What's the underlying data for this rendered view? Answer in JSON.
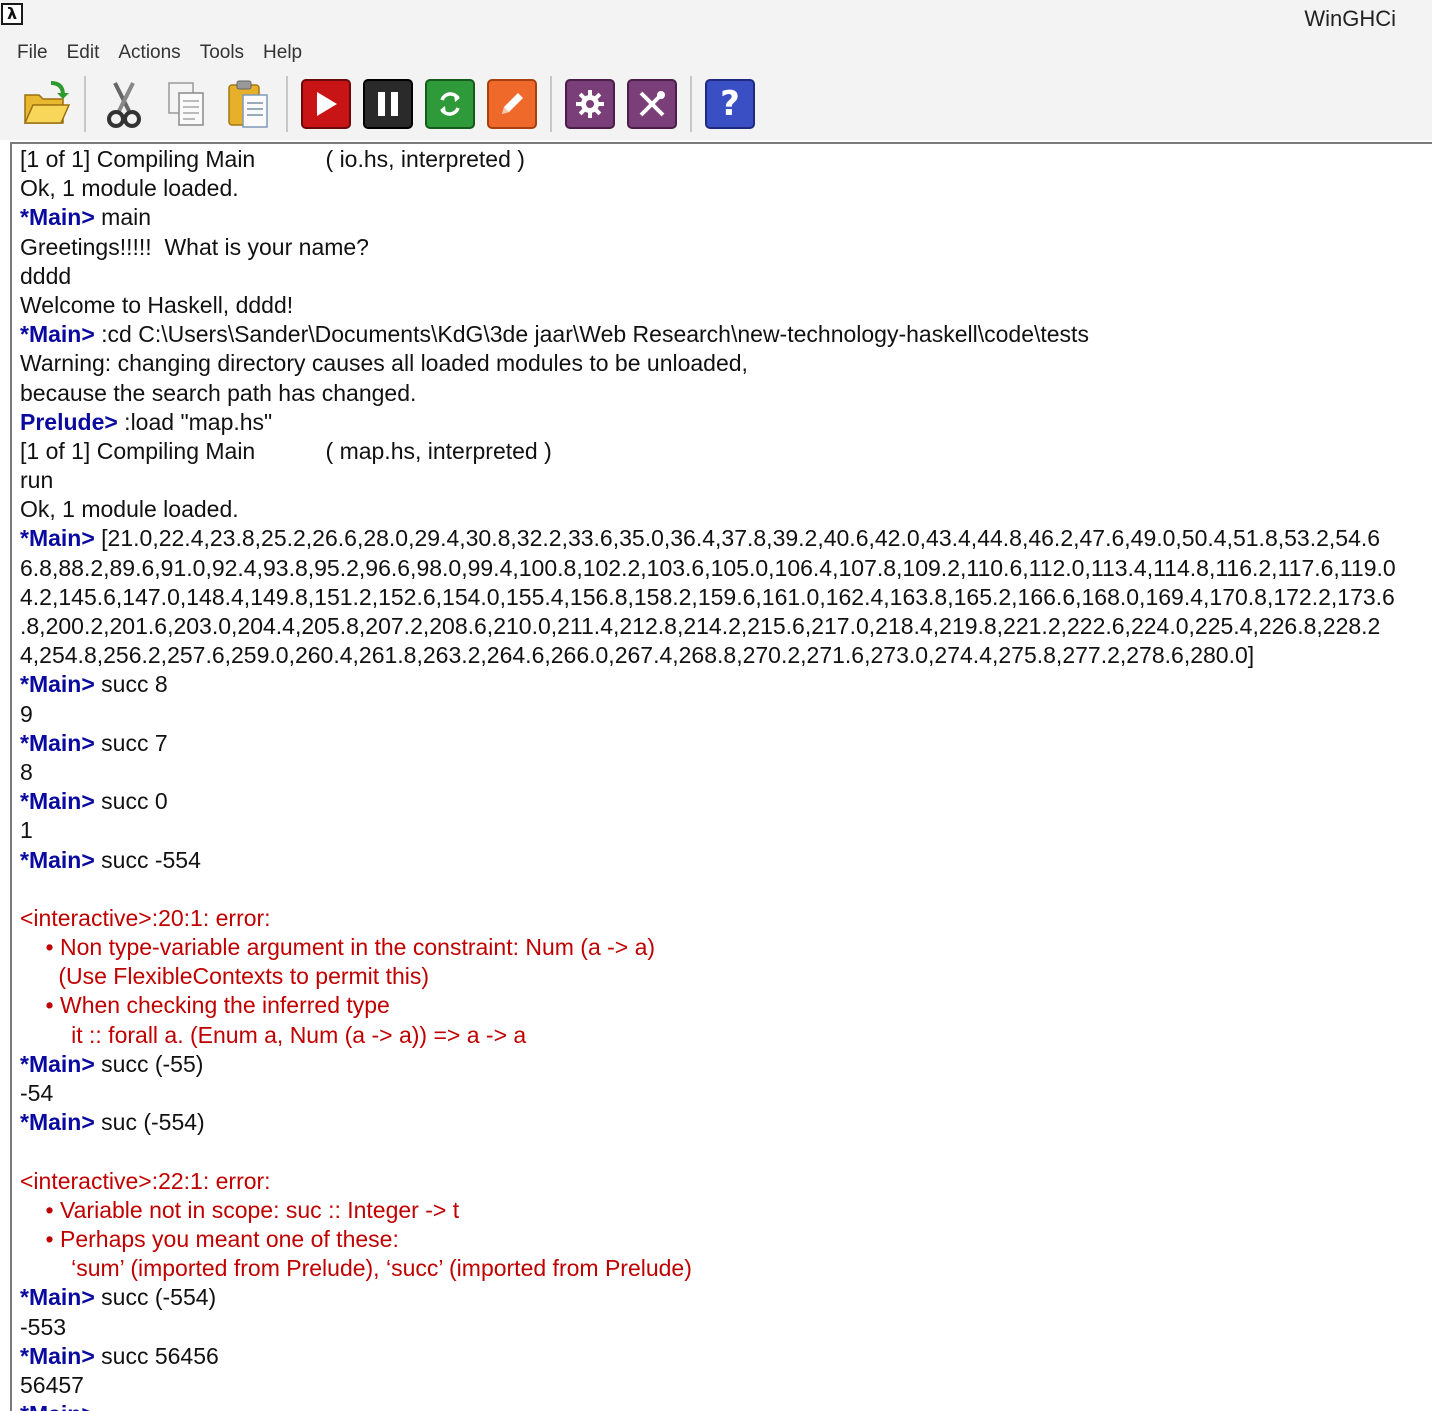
{
  "window": {
    "title": "WinGHCi",
    "app_icon_glyph": "λ"
  },
  "menu": [
    "File",
    "Edit",
    "Actions",
    "Tools",
    "Help"
  ],
  "toolbar": {
    "buttons": [
      {
        "name": "open-folder-button",
        "icon": "open-folder-icon"
      },
      {
        "name": "cut-button",
        "icon": "scissors-icon"
      },
      {
        "name": "copy-button",
        "icon": "copy-icon"
      },
      {
        "name": "paste-button",
        "icon": "clipboard-icon"
      },
      {
        "name": "run-button",
        "icon": "play-icon"
      },
      {
        "name": "pause-button",
        "icon": "pause-icon"
      },
      {
        "name": "reload-button",
        "icon": "reload-icon"
      },
      {
        "name": "edit-button",
        "icon": "pencil-icon"
      },
      {
        "name": "options-button",
        "icon": "gear-icon"
      },
      {
        "name": "tools-button",
        "icon": "wrench-screwdriver-icon"
      },
      {
        "name": "help-button",
        "icon": "question-icon"
      }
    ]
  },
  "colors": {
    "prompt": "#0a0aa0",
    "error": "#c00000",
    "text": "#111111"
  },
  "console_lines": [
    {
      "type": "out",
      "text": "[1 of 1] Compiling Main           ( io.hs, interpreted )"
    },
    {
      "type": "out",
      "text": "Ok, 1 module loaded."
    },
    {
      "type": "cmd",
      "prompt": "*Main>",
      "text": " main"
    },
    {
      "type": "out",
      "text": "Greetings!!!!!  What is your name?"
    },
    {
      "type": "out",
      "text": "dddd"
    },
    {
      "type": "out",
      "text": "Welcome to Haskell, dddd!"
    },
    {
      "type": "cmd",
      "prompt": "*Main>",
      "text": " :cd C:\\Users\\Sander\\Documents\\KdG\\3de jaar\\Web Research\\new-technology-haskell\\code\\tests"
    },
    {
      "type": "out",
      "text": "Warning: changing directory causes all loaded modules to be unloaded,"
    },
    {
      "type": "out",
      "text": "because the search path has changed."
    },
    {
      "type": "cmd",
      "prompt": "Prelude>",
      "text": " :load \"map.hs\""
    },
    {
      "type": "out",
      "text": "[1 of 1] Compiling Main           ( map.hs, interpreted )"
    },
    {
      "type": "out",
      "text": "run"
    },
    {
      "type": "out",
      "text": "Ok, 1 module loaded."
    },
    {
      "type": "cmd",
      "prompt": "*Main>",
      "text": " [21.0,22.4,23.8,25.2,26.6,28.0,29.4,30.8,32.2,33.6,35.0,36.4,37.8,39.2,40.6,42.0,43.4,44.8,46.2,47.6,49.0,50.4,51.8,53.2,54.6"
    },
    {
      "type": "out",
      "text": "6.8,88.2,89.6,91.0,92.4,93.8,95.2,96.6,98.0,99.4,100.8,102.2,103.6,105.0,106.4,107.8,109.2,110.6,112.0,113.4,114.8,116.2,117.6,119.0"
    },
    {
      "type": "out",
      "text": "4.2,145.6,147.0,148.4,149.8,151.2,152.6,154.0,155.4,156.8,158.2,159.6,161.0,162.4,163.8,165.2,166.6,168.0,169.4,170.8,172.2,173.6"
    },
    {
      "type": "out",
      "text": ".8,200.2,201.6,203.0,204.4,205.8,207.2,208.6,210.0,211.4,212.8,214.2,215.6,217.0,218.4,219.8,221.2,222.6,224.0,225.4,226.8,228.2"
    },
    {
      "type": "out",
      "text": "4,254.8,256.2,257.6,259.0,260.4,261.8,263.2,264.6,266.0,267.4,268.8,270.2,271.6,273.0,274.4,275.8,277.2,278.6,280.0]"
    },
    {
      "type": "cmd",
      "prompt": "*Main>",
      "text": " succ 8"
    },
    {
      "type": "out",
      "text": "9"
    },
    {
      "type": "cmd",
      "prompt": "*Main>",
      "text": " succ 7"
    },
    {
      "type": "out",
      "text": "8"
    },
    {
      "type": "cmd",
      "prompt": "*Main>",
      "text": " succ 0"
    },
    {
      "type": "out",
      "text": "1"
    },
    {
      "type": "cmd",
      "prompt": "*Main>",
      "text": " succ -554"
    },
    {
      "type": "out",
      "text": ""
    },
    {
      "type": "err",
      "text": "<interactive>:20:1: error:"
    },
    {
      "type": "err",
      "text": "    • Non type-variable argument in the constraint: Num (a -> a)"
    },
    {
      "type": "err",
      "text": "      (Use FlexibleContexts to permit this)"
    },
    {
      "type": "err",
      "text": "    • When checking the inferred type"
    },
    {
      "type": "err",
      "text": "        it :: forall a. (Enum a, Num (a -> a)) => a -> a"
    },
    {
      "type": "cmd",
      "prompt": "*Main>",
      "text": " succ (-55)"
    },
    {
      "type": "out",
      "text": "-54"
    },
    {
      "type": "cmd",
      "prompt": "*Main>",
      "text": " suc (-554)"
    },
    {
      "type": "out",
      "text": ""
    },
    {
      "type": "err",
      "text": "<interactive>:22:1: error:"
    },
    {
      "type": "err",
      "text": "    • Variable not in scope: suc :: Integer -> t"
    },
    {
      "type": "err",
      "text": "    • Perhaps you meant one of these:"
    },
    {
      "type": "err",
      "text": "        ‘sum’ (imported from Prelude), ‘succ’ (imported from Prelude)"
    },
    {
      "type": "cmd",
      "prompt": "*Main>",
      "text": " succ (-554)"
    },
    {
      "type": "out",
      "text": "-553"
    },
    {
      "type": "cmd",
      "prompt": "*Main>",
      "text": " succ 56456"
    },
    {
      "type": "out",
      "text": "56457"
    },
    {
      "type": "cmd",
      "prompt": "*Main>",
      "text": ""
    }
  ]
}
